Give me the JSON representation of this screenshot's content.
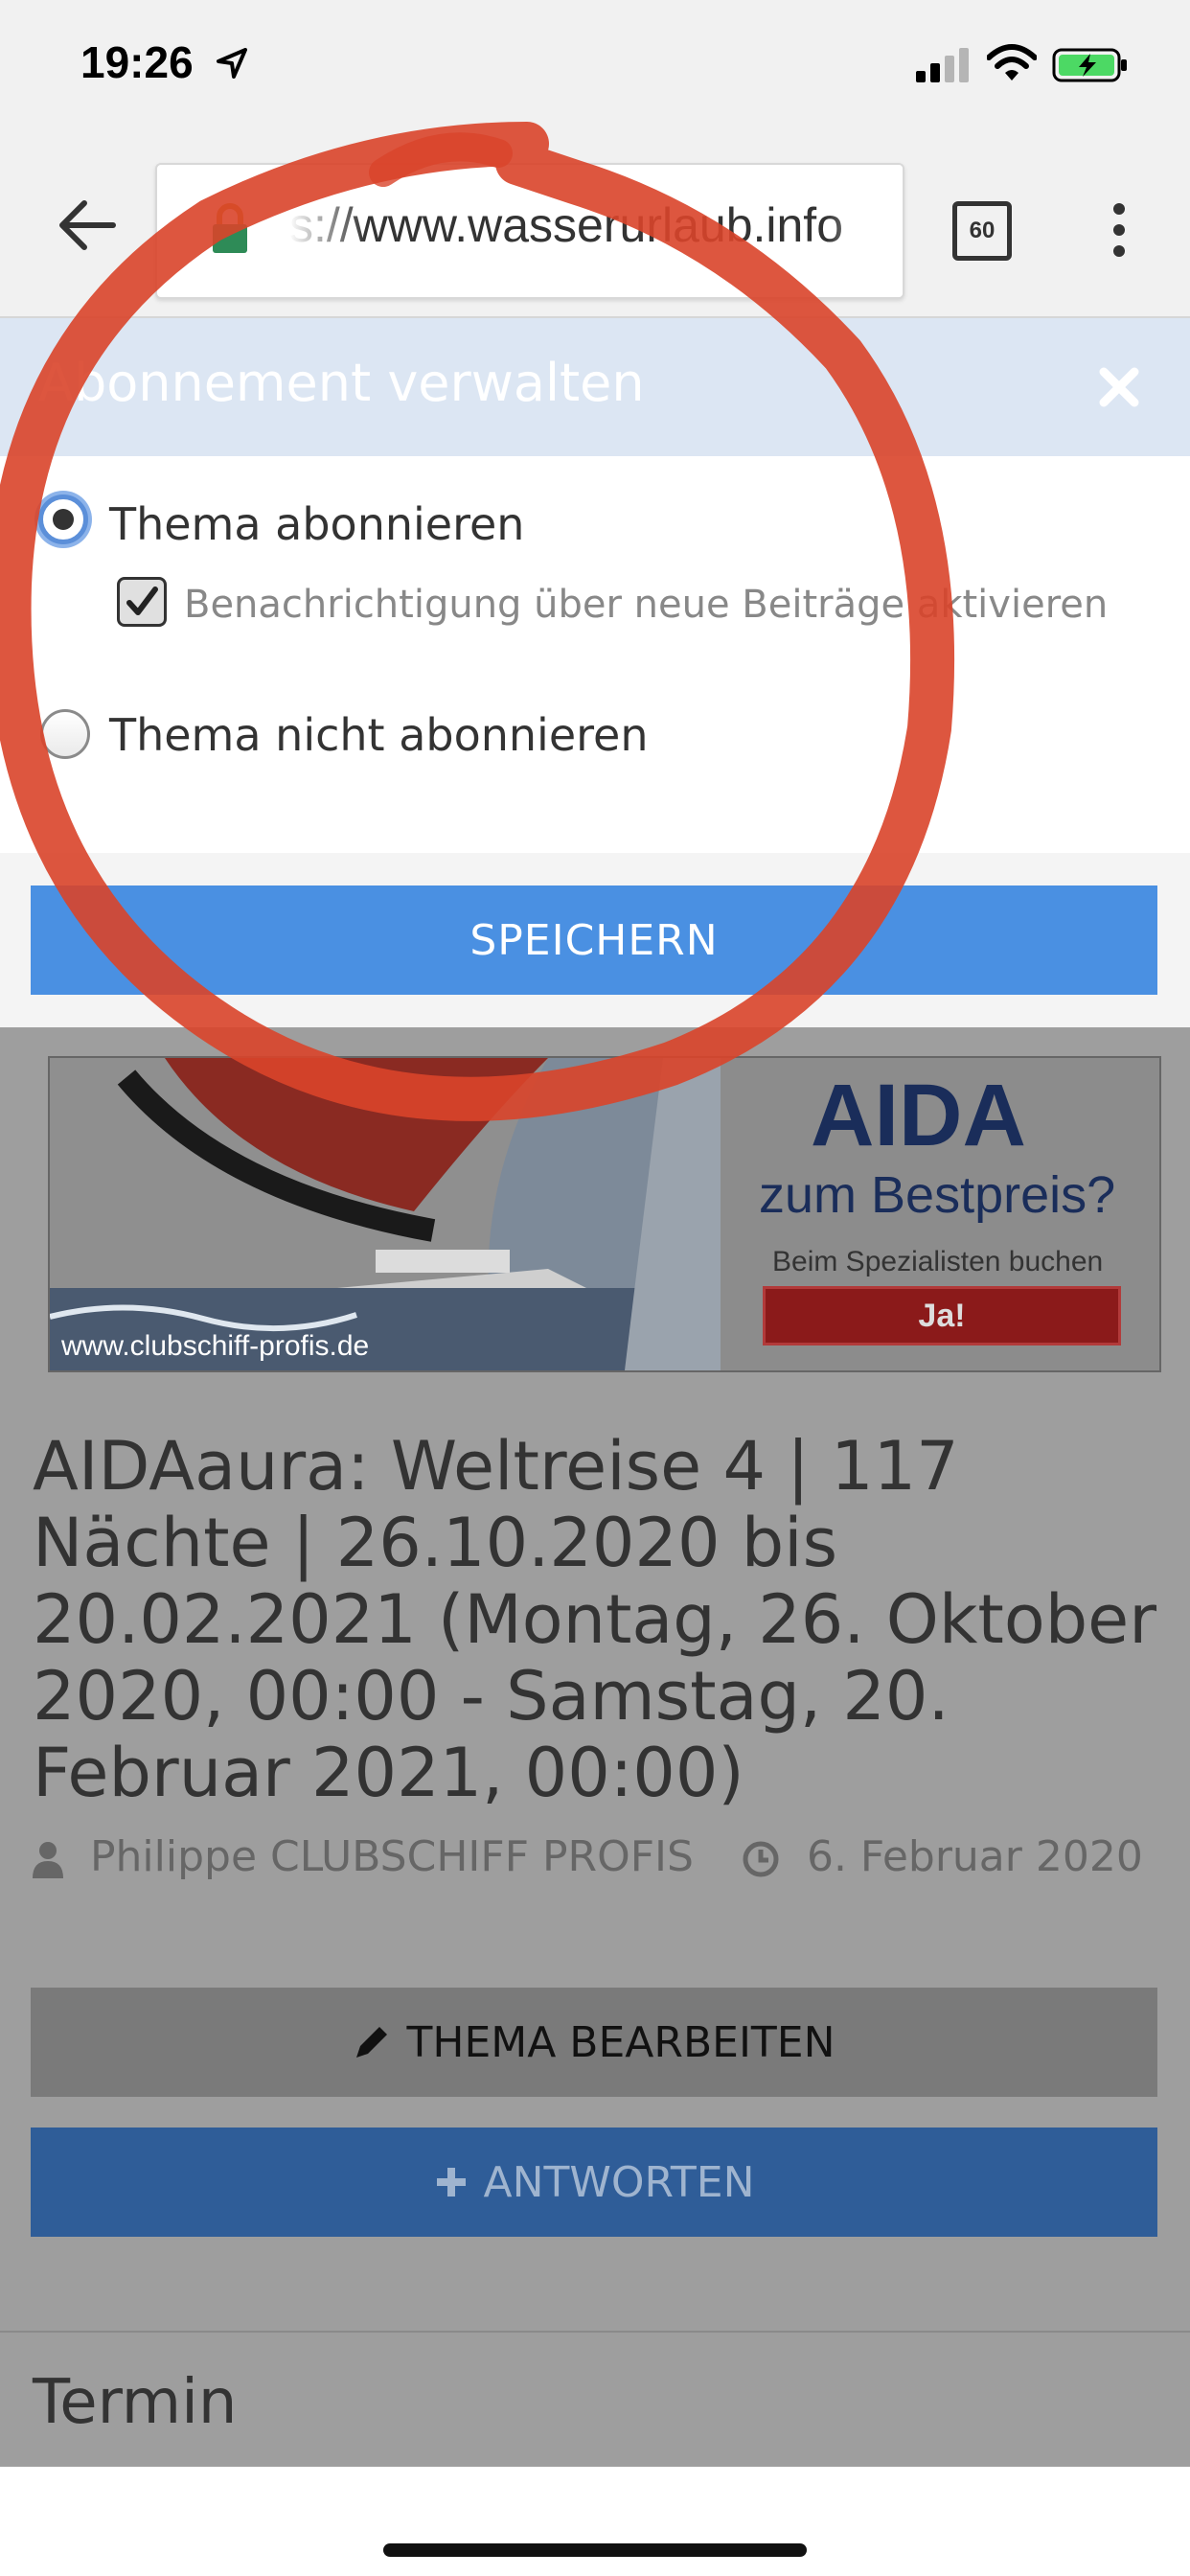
{
  "status_bar": {
    "time": "19:26",
    "location_icon": "location-arrow-icon",
    "signal_icon": "cellular-signal-icon",
    "wifi_icon": "wifi-icon",
    "battery_icon": "battery-charging-icon"
  },
  "browser": {
    "url": "s://www.wasserurlaub.info",
    "tab_count": "60",
    "back_icon": "back-arrow-icon",
    "lock_icon": "lock-icon",
    "menu_icon": "kebab-menu-icon"
  },
  "modal": {
    "title": "Abonnement verwalten",
    "close_icon": "close-icon",
    "option_subscribe": "Thema abonnieren",
    "option_notify": "Benachrichtigung über neue Beiträge aktivieren",
    "option_unsubscribe": "Thema nicht abonnieren",
    "selected": "Thema abonnieren",
    "notify_checked": true,
    "save_label": "SPEICHERN"
  },
  "ad": {
    "site": "www.clubschiff-profis.de",
    "brand": "AIDA",
    "headline": "zum Bestpreis?",
    "subline": "Beim Spezialisten buchen",
    "cta": "Ja!"
  },
  "thread": {
    "title": "AIDAaura: Weltreise 4 | 117 Nächte | 26.10.2020 bis 20.02.2021 (Montag, 26. Oktober 2020, 00:00 - Samstag, 20. Februar 2021, 00:00)",
    "author": "Philippe CLUBSCHIFF PROFIS",
    "date": "6. Februar 2020",
    "edit_label": "THEMA BEARBEITEN",
    "reply_label": "ANTWORTEN",
    "section": "Termin"
  },
  "colors": {
    "accent": "#4a90e2",
    "annotation": "#d9442a",
    "reply": "#2f5d98"
  }
}
